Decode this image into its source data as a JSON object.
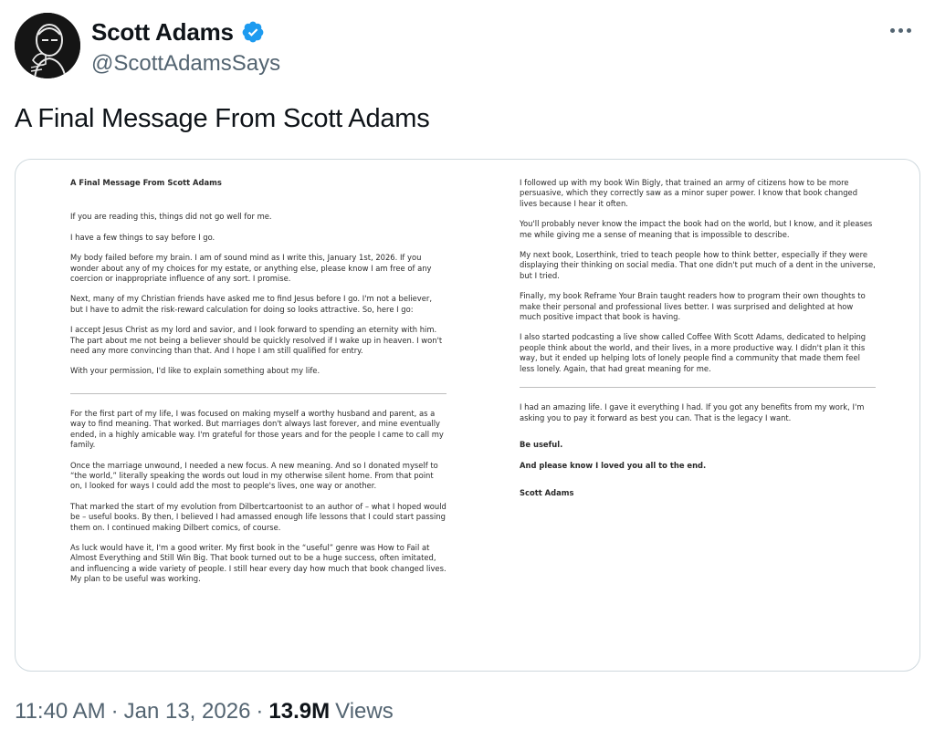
{
  "author": {
    "name": "Scott Adams",
    "handle": "@ScottAdamsSays",
    "verified": true,
    "avatar_icon": "avatar-portrait",
    "verified_icon": "verified-badge-icon"
  },
  "more_icon": "more-options-icon",
  "tweet": {
    "text": "A Final Message From Scott Adams"
  },
  "document": {
    "left": {
      "title": "A Final Message From Scott Adams",
      "paragraphs_top": [
        "If you are reading this, things did not go well for me.",
        "I have a few things to say before I go.",
        "My body failed before my brain. I am of sound mind as I write this, January 1st, 2026. If you wonder about any of my choices for my estate, or anything else, please know I am free of any coercion or inappropriate influence of any sort. I promise.",
        "Next, many of my Christian friends have asked me to find Jesus before I go. I'm not a believer, but I have to admit the risk-reward calculation for doing so looks attractive. So, here I go:",
        "I accept Jesus Christ as my lord and savior, and I look forward to spending an eternity with him. The part about me not being a believer should be quickly resolved if I wake up in heaven. I won't need any more convincing than that. And I hope I am still qualified for entry.",
        "With your permission, I'd like to explain something about my life."
      ],
      "paragraphs_bottom": [
        "For the first part of my life, I was focused on making myself a worthy husband and parent, as a way to find meaning. That worked. But marriages don't always last forever, and mine eventually ended, in a highly amicable way. I'm grateful for those years and for the people I came to call my family.",
        "Once the marriage unwound, I needed a new focus. A new meaning. And so I donated myself to “the world,” literally speaking the words out loud in my otherwise silent home. From that point on, I  looked for ways I could add the most to people's lives, one way or another.",
        "That marked the start of my evolution from Dilbertcartoonist to an author of – what I hoped would be – useful books. By then, I believed I had amassed enough life lessons that I could start passing them on. I continued making Dilbert comics, of course.",
        "As luck would have it, I'm a good writer. My first book in the “useful” genre was How to Fail at Almost Everything and Still Win Big. That book turned out to be a huge success, often imitated, and influencing a wide variety of people. I still hear every day how much that book changed lives. My plan to be useful was working."
      ]
    },
    "right": {
      "paragraphs_top": [
        "I followed up with my book Win Bigly, that trained an army of citizens how to be more persuasive, which they correctly saw as a minor super power. I know that book changed lives because I hear it often.",
        "You'll probably never know the impact the book had on the world, but I know, and it pleases me while giving me a sense of meaning that is impossible to describe.",
        "My next book, Loserthink, tried to teach people how to think better, especially if they were displaying their thinking on social media. That one didn't put much of a dent in the universe, but I tried.",
        "Finally, my book Reframe Your Brain taught readers how to program their own thoughts to make their personal and professional lives better. I was surprised and delighted at how much positive impact that book is having.",
        "I also started podcasting a live show called Coffee With Scott Adams, dedicated to helping people think about the world, and their lives, in a more productive way. I didn't plan it this way, but it ended up helping lots of lonely people find a community that made them feel less lonely. Again, that had great meaning for me."
      ],
      "paragraph_after_rule": "I had an amazing life. I gave it everything I had. If you got any benefits from my work, I'm asking you to pay it forward as best you can. That is the legacy I want.",
      "closing_1": "Be useful.",
      "closing_2": "And please know I loved you all to the end.",
      "signature": "Scott Adams"
    }
  },
  "footer": {
    "time": "11:40 AM",
    "separator": "·",
    "date": "Jan 13, 2026",
    "views_count": "13.9M",
    "views_label": "Views"
  },
  "colors": {
    "text_primary": "#0f1419",
    "text_secondary": "#536471",
    "verified_blue": "#1d9bf0",
    "border": "#cfd9de"
  }
}
